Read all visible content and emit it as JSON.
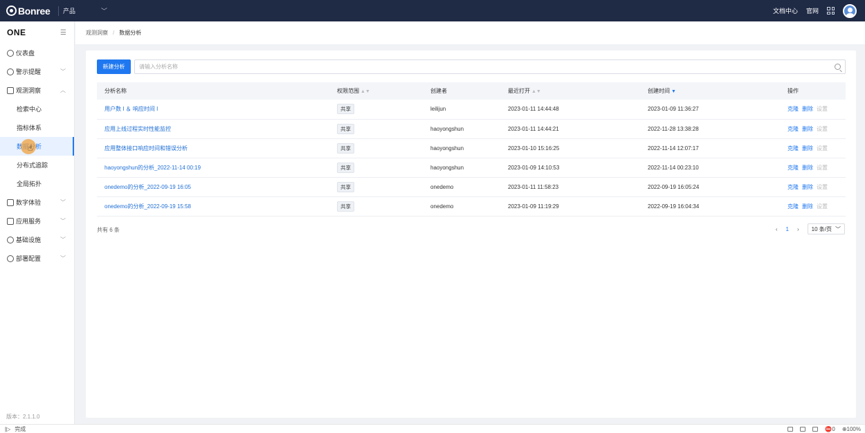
{
  "topbar": {
    "logo_text": "Bonree",
    "product_label": "产品",
    "links": [
      "文档中心",
      "官网"
    ]
  },
  "sidebar": {
    "brand": "ONE",
    "items": [
      {
        "label": "仪表盘",
        "icon": "dashboard-icon"
      },
      {
        "label": "警示提醒",
        "icon": "alert-icon",
        "expandable": true
      },
      {
        "label": "观测洞察",
        "icon": "insight-icon",
        "expanded": true,
        "children": [
          "检索中心",
          "指标体系",
          "数据分析",
          "分布式追踪",
          "全局拓扑"
        ],
        "active_child": "数据分析"
      },
      {
        "label": "数字体验",
        "icon": "experience-icon",
        "expandable": true
      },
      {
        "label": "应用服务",
        "icon": "app-service-icon",
        "expandable": true
      },
      {
        "label": "基础设施",
        "icon": "infrastructure-icon",
        "expandable": true
      },
      {
        "label": "部署配置",
        "icon": "deploy-config-icon",
        "expandable": true
      }
    ],
    "version": "版本：2.1.1.0"
  },
  "breadcrumb": {
    "parent": "观测洞察",
    "current": "数据分析"
  },
  "toolbar": {
    "new_button": "新建分析",
    "search_placeholder": "请输入分析名称"
  },
  "table": {
    "columns": [
      "分析名称",
      "权限范围",
      "创建者",
      "最近打开",
      "创建时间",
      "操作"
    ],
    "rows": [
      {
        "name": "用户数 I ＆ 响应时间 I",
        "scope": "共享",
        "creator": "leilijun",
        "last_open": "2023-01-11 14:44:48",
        "created": "2023-01-09 11:36:27"
      },
      {
        "name": "应用上线过程实时性能监控",
        "scope": "共享",
        "creator": "haoyongshun",
        "last_open": "2023-01-11 14:44:21",
        "created": "2022-11-28 13:38:28"
      },
      {
        "name": "应用整体接口响应时间和错误分析",
        "scope": "共享",
        "creator": "haoyongshun",
        "last_open": "2023-01-10 15:16:25",
        "created": "2022-11-14 12:07:17"
      },
      {
        "name": "haoyongshun的分析_2022-11-14 00:19",
        "scope": "共享",
        "creator": "haoyongshun",
        "last_open": "2023-01-09 14:10:53",
        "created": "2022-11-14 00:23:10"
      },
      {
        "name": "onedemo的分析_2022-09-19 16:05",
        "scope": "共享",
        "creator": "onedemo",
        "last_open": "2023-01-11 11:58:23",
        "created": "2022-09-19 16:05:24"
      },
      {
        "name": "onedemo的分析_2022-09-19 15:58",
        "scope": "共享",
        "creator": "onedemo",
        "last_open": "2023-01-09 11:19:29",
        "created": "2022-09-19 16:04:34"
      }
    ],
    "actions": [
      "克隆",
      "删除",
      "设置"
    ]
  },
  "pagination": {
    "total": "共有 6 条",
    "page": "1",
    "page_size": "10 条/页"
  },
  "statusbar": {
    "status": "完成",
    "zoom": "100%",
    "count": "0"
  }
}
